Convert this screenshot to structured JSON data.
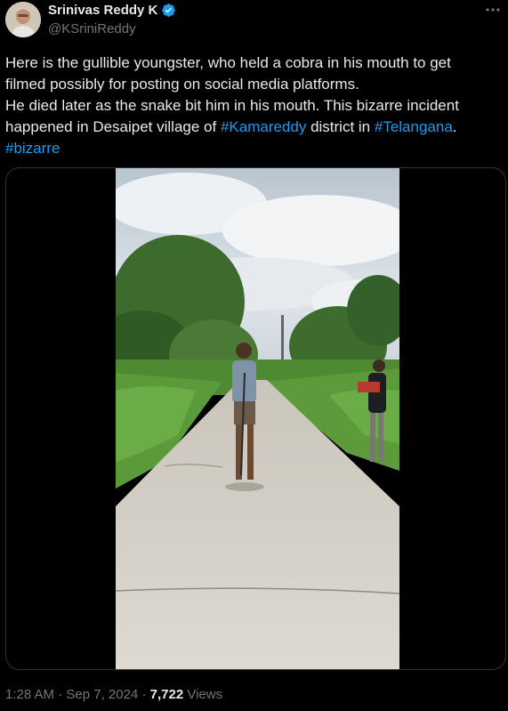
{
  "author": {
    "name": "Srinivas Reddy K",
    "handle": "@KSriniReddy",
    "verified_color": "#1d9bf0",
    "avatar_icon": "person-portrait"
  },
  "tweet": {
    "line1": "Here is the gullible youngster, who held a cobra in his mouth to get",
    "line2": "filmed possibly for posting on social media platforms.",
    "line3": "He died later as the snake bit him in his mouth. This bizarre incident",
    "line4_a": "happened in Desaipet village of ",
    "line4_tag1": "#Kamareddy",
    "line4_b": " district in ",
    "line4_tag2": "#Telangana",
    "line4_c": ".",
    "line5_tag": "#bizarre"
  },
  "footer": {
    "time": "1:28 AM",
    "sep1": " · ",
    "date": "Sep 7, 2024",
    "sep2": " · ",
    "views_count": "7,722",
    "views_label": " Views"
  },
  "colors": {
    "background": "#000000",
    "text": "#e7e9ea",
    "muted": "#71767b",
    "link": "#1d9bf0"
  }
}
